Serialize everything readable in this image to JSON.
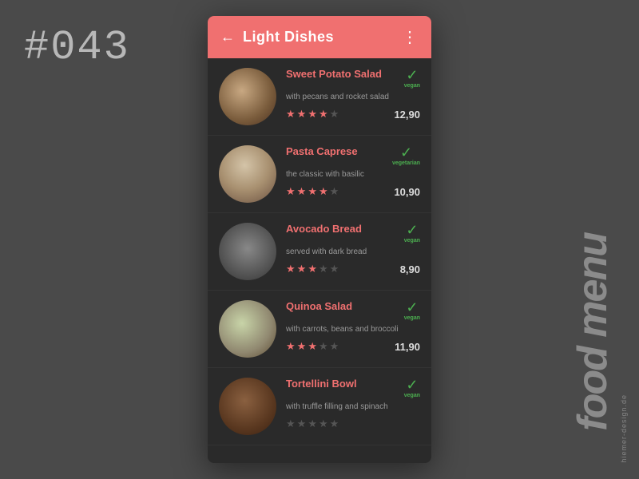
{
  "page": {
    "number": "#043",
    "brand": "food menu",
    "watermark": "hiemer-design.de"
  },
  "header": {
    "title": "Light Dishes",
    "back_label": "←",
    "menu_label": "⋮"
  },
  "menu_items": [
    {
      "id": 1,
      "name": "Sweet Potato Salad",
      "description": "with pecans and rocket salad",
      "diet": "vegan",
      "rating": 4,
      "max_rating": 5,
      "price": "12,90",
      "image_class": "food-img-1"
    },
    {
      "id": 2,
      "name": "Pasta Caprese",
      "description": "the classic with basilic",
      "diet": "vegetarian",
      "rating": 4,
      "max_rating": 5,
      "price": "10,90",
      "image_class": "food-img-2"
    },
    {
      "id": 3,
      "name": "Avocado Bread",
      "description": "served with dark bread",
      "diet": "vegan",
      "rating": 3,
      "max_rating": 5,
      "price": "8,90",
      "image_class": "food-img-3"
    },
    {
      "id": 4,
      "name": "Quinoa Salad",
      "description": "with carrots, beans and broccoli",
      "diet": "vegan",
      "rating": 3,
      "max_rating": 5,
      "price": "11,90",
      "image_class": "food-img-4"
    },
    {
      "id": 5,
      "name": "Tortellini Bowl",
      "description": "with truffle filling and spinach",
      "diet": "vegan",
      "rating": 0,
      "max_rating": 5,
      "price": "",
      "image_class": "food-img-5"
    }
  ]
}
